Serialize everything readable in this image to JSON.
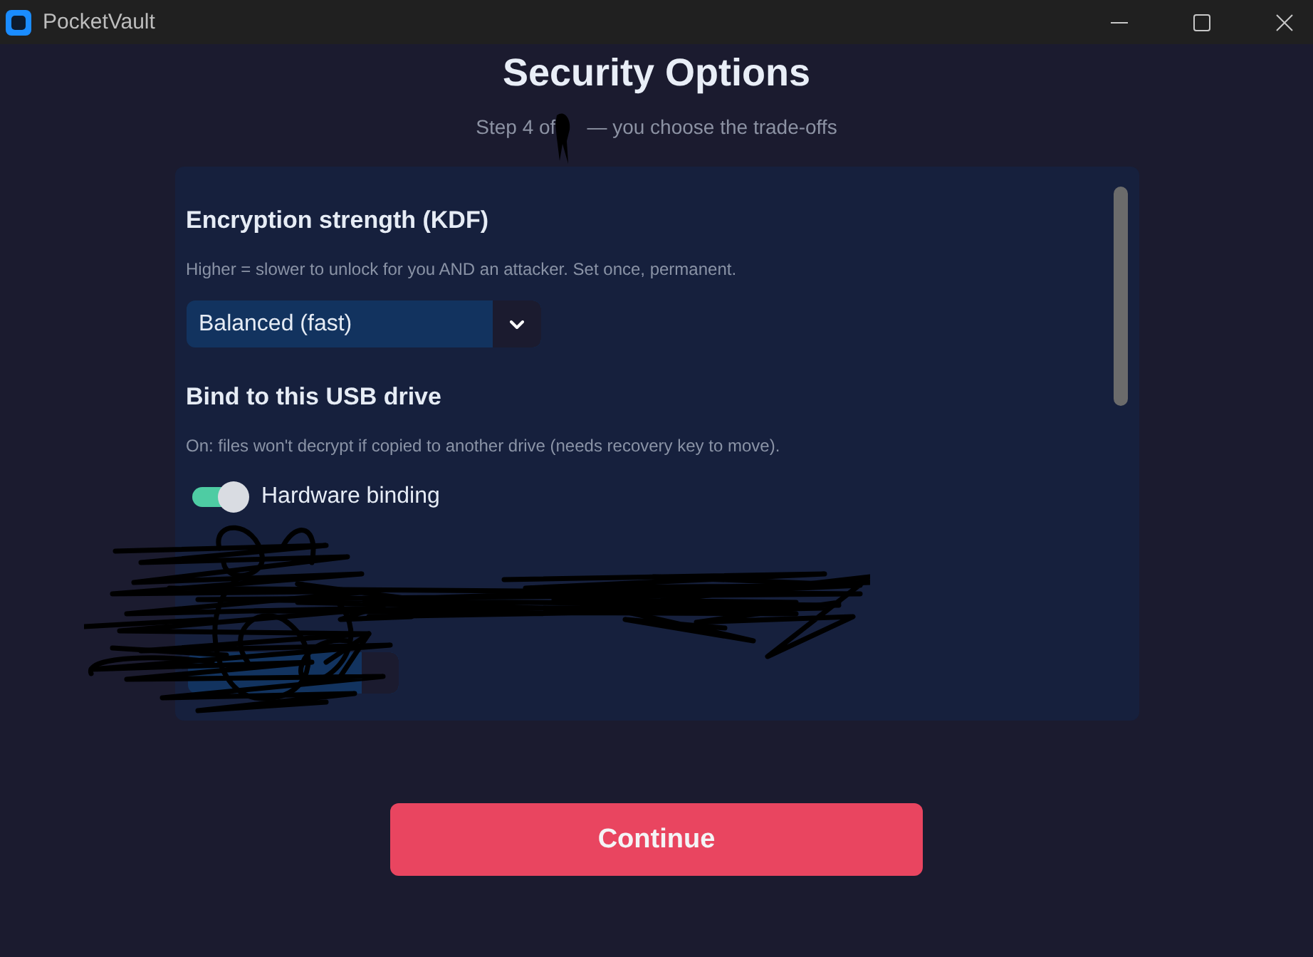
{
  "window": {
    "title": "PocketVault"
  },
  "header": {
    "title": "Security Options",
    "step_prefix": "Step 4 of",
    "step_suffix": "— you choose the trade-offs"
  },
  "sections": [
    {
      "kind": "select",
      "heading": "Encryption strength (KDF)",
      "description": "Higher = slower to unlock for you AND an attacker. Set once, permanent.",
      "value": "Balanced (fast)"
    },
    {
      "kind": "toggle",
      "heading": "Bind to this USB drive",
      "description": "On: files won't decrypt if copied to another drive (needs recovery key to move).",
      "label": "Hardware binding",
      "on": true
    },
    {
      "kind": "redacted"
    }
  ],
  "continue_button": {
    "label": "Continue"
  }
}
